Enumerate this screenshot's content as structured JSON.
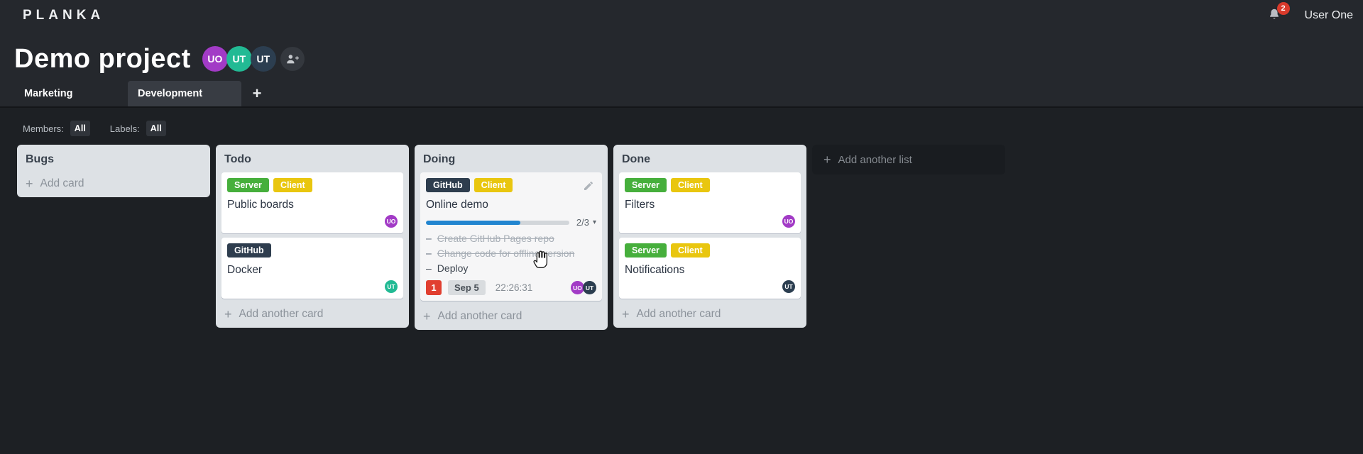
{
  "header": {
    "logo": "PLANKA",
    "notifications_count": "2",
    "user_name": "User One"
  },
  "project": {
    "title": "Demo project",
    "members": [
      {
        "initials": "UO",
        "color": "#a23bc6"
      },
      {
        "initials": "UT",
        "color": "#22ba94"
      },
      {
        "initials": "UT",
        "color": "#2c3e50"
      }
    ]
  },
  "tabs": [
    {
      "label": "Marketing",
      "active": false
    },
    {
      "label": "Development",
      "active": true
    }
  ],
  "filters": {
    "members_label": "Members:",
    "members_value": "All",
    "labels_label": "Labels:",
    "labels_value": "All"
  },
  "board": {
    "add_list_label": "Add another list",
    "lists": [
      {
        "title": "Bugs",
        "add_label": "Add card",
        "cards": []
      },
      {
        "title": "Todo",
        "add_label": "Add another card",
        "cards": [
          {
            "title": "Public boards",
            "labels": [
              {
                "text": "Server",
                "color": "#46af3c"
              },
              {
                "text": "Client",
                "color": "#e9c60f"
              }
            ],
            "members": [
              {
                "initials": "UO",
                "color": "#a23bc6"
              }
            ]
          },
          {
            "title": "Docker",
            "labels": [
              {
                "text": "GitHub",
                "color": "#2e3d4e"
              }
            ],
            "members": [
              {
                "initials": "UT",
                "color": "#22ba94"
              }
            ]
          }
        ]
      },
      {
        "title": "Doing",
        "add_label": "Add another card",
        "cards": [
          {
            "title": "Online demo",
            "tinted": true,
            "editable": true,
            "labels": [
              {
                "text": "GitHub",
                "color": "#2e3d4e"
              },
              {
                "text": "Client",
                "color": "#e9c60f"
              }
            ],
            "progress": {
              "percent": 66,
              "label": "2/3"
            },
            "tasks": [
              {
                "text": "Create GitHub Pages repo",
                "done": true
              },
              {
                "text": "Change code for offline version",
                "done": true
              },
              {
                "text": "Deploy",
                "done": false
              }
            ],
            "due_badge": "1",
            "date_badge": "Sep 5",
            "timer": "22:26:31",
            "members": [
              {
                "initials": "UO",
                "color": "#a23bc6"
              },
              {
                "initials": "UT",
                "color": "#2c3e50"
              }
            ]
          }
        ]
      },
      {
        "title": "Done",
        "add_label": "Add another card",
        "cards": [
          {
            "title": "Filters",
            "labels": [
              {
                "text": "Server",
                "color": "#46af3c"
              },
              {
                "text": "Client",
                "color": "#e9c60f"
              }
            ],
            "members": [
              {
                "initials": "UO",
                "color": "#a23bc6"
              }
            ]
          },
          {
            "title": "Notifications",
            "labels": [
              {
                "text": "Server",
                "color": "#46af3c"
              },
              {
                "text": "Client",
                "color": "#e9c60f"
              }
            ],
            "members": [
              {
                "initials": "UT",
                "color": "#2c3e50"
              }
            ]
          }
        ]
      }
    ]
  },
  "icons": {
    "plus": "+",
    "caret_down": "▾",
    "task_dash": "–"
  },
  "cursor": {
    "type": "open-hand"
  }
}
